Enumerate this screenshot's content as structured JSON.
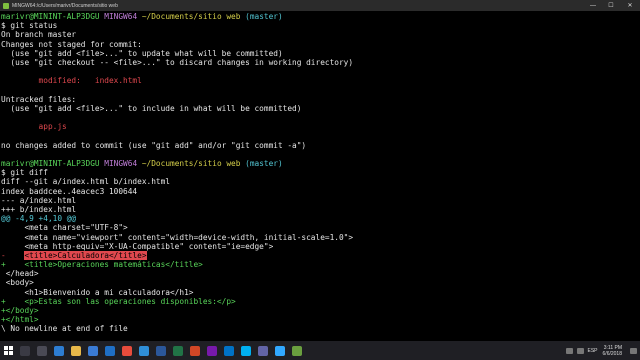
{
  "window": {
    "title": "MINGW64:/c/Users/marivr/Documents/sitio web",
    "minimize_glyph": "—",
    "maximize_glyph": "☐",
    "close_glyph": "✕"
  },
  "terminal": {
    "prompt": {
      "user": "marivr@MININT-ALP3DGU",
      "env": "MINGW64",
      "path": "~/Documents/sitio web",
      "branch": "(master)"
    },
    "status": {
      "command": "$ git status",
      "on_branch": "On branch master",
      "changes_header": "Changes not staged for commit:",
      "hint_add": "  (use \"git add <file>...\" to update what will be committed)",
      "hint_checkout": "  (use \"git checkout -- <file>...\" to discard changes in working directory)",
      "modified_label": "        modified:   index.html",
      "untracked_header": "Untracked files:",
      "untracked_hint": "  (use \"git add <file>...\" to include in what will be committed)",
      "untracked_file": "        app.js",
      "no_changes": "no changes added to commit (use \"git add\" and/or \"git commit -a\")"
    },
    "diff": {
      "command": "$ git diff",
      "header_1": "diff --git a/index.html b/index.html",
      "header_2": "index baddcee..4eacec3 100644",
      "header_3": "--- a/index.html",
      "header_4": "+++ b/index.html",
      "hunk": "@@ -4,9 +4,10 @@",
      "ctx_1": "     <meta charset=\"UTF-8\">",
      "ctx_2": "     <meta name=\"viewport\" content=\"width=device-width, initial-scale=1.0\">",
      "ctx_3": "     <meta http-equiv=\"X-UA-Compatible\" content=\"ie=edge\">",
      "removed_marker": "-    ",
      "removed_text": "<title>Calculadora</title>",
      "added_1": "+    <title>Operaciones matemáticas</title>",
      "ctx_4": " </head>",
      "ctx_5": " <body>",
      "ctx_6": "     <h1>Bienvenido a mi calculadora</h1>",
      "added_2": "+    <p>Estas son las operaciones disponibles:</p>",
      "added_3": "+</body>",
      "added_4": "+</html>",
      "no_newline": "\\ No newline at end of file"
    },
    "last_prompt": "$"
  },
  "taskbar": {
    "time": "3:11 PM",
    "date": "6/6/2018",
    "language": "ESP",
    "apps": [
      {
        "name": "search-icon",
        "color": "#3a3a44"
      },
      {
        "name": "task-view-icon",
        "color": "#4a4a55"
      },
      {
        "name": "edge-icon",
        "color": "#2d7dd2"
      },
      {
        "name": "explorer-icon",
        "color": "#e8b84a"
      },
      {
        "name": "store-icon",
        "color": "#3a7bd5"
      },
      {
        "name": "mail-icon",
        "color": "#1f6fc5"
      },
      {
        "name": "chrome-icon",
        "color": "#e74c3c"
      },
      {
        "name": "vscode-icon",
        "color": "#2f8fd8"
      },
      {
        "name": "word-icon",
        "color": "#2b579a"
      },
      {
        "name": "excel-icon",
        "color": "#217346"
      },
      {
        "name": "powerpoint-icon",
        "color": "#d24726"
      },
      {
        "name": "onenote-icon",
        "color": "#7719aa"
      },
      {
        "name": "outlook-icon",
        "color": "#0072c6"
      },
      {
        "name": "skype-icon",
        "color": "#00aff0"
      },
      {
        "name": "teams-icon",
        "color": "#6264a7"
      },
      {
        "name": "photoshop-icon",
        "color": "#31a8ff"
      },
      {
        "name": "git-bash-icon",
        "color": "#6a9f3f"
      }
    ]
  }
}
